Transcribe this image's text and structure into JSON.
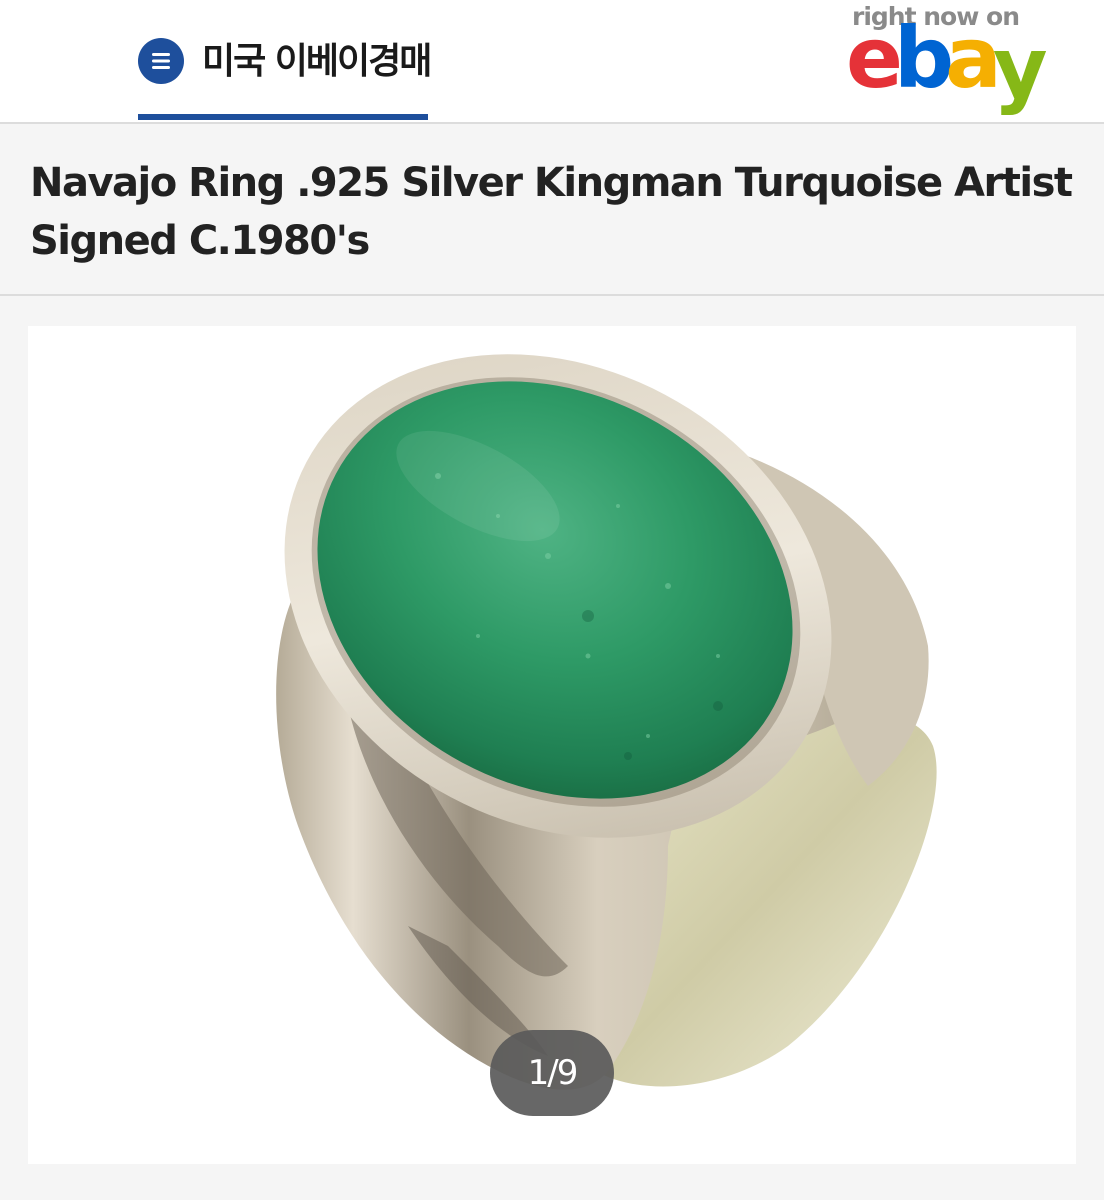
{
  "header": {
    "nav_label": "미국 이베이경매",
    "menu_icon": "menu-icon",
    "accent_color": "#1e4f9c",
    "brand": {
      "tagline": "right now on",
      "letters": [
        {
          "char": "e",
          "color": "#e53238"
        },
        {
          "char": "b",
          "color": "#0064d2"
        },
        {
          "char": "a",
          "color": "#f5af02"
        },
        {
          "char": "y",
          "color": "#86b817"
        }
      ]
    }
  },
  "listing": {
    "title": "Navajo Ring .925 Silver Kingman Turquoise Artist Signed C.1980's",
    "gallery": {
      "counter": "1/9"
    }
  }
}
